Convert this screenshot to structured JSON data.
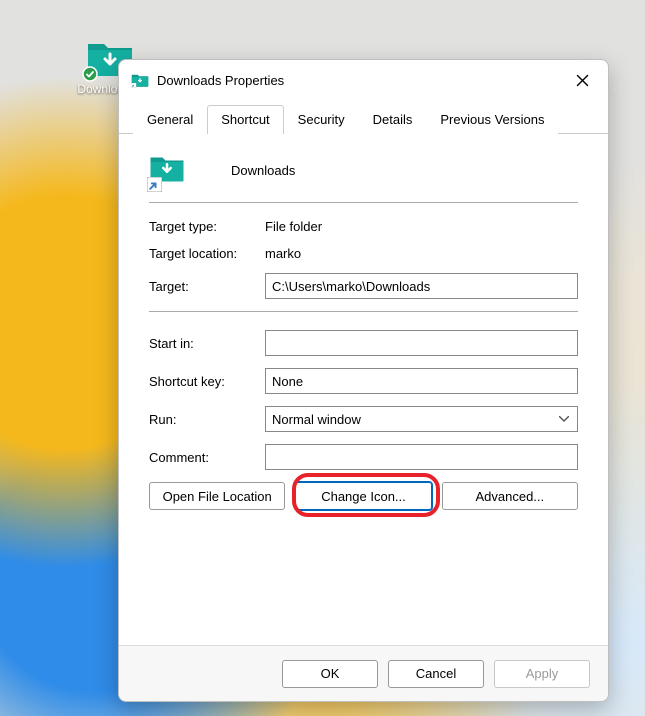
{
  "desktop": {
    "icon_label": "Download…"
  },
  "dialog": {
    "title": "Downloads Properties",
    "tabs": [
      "General",
      "Shortcut",
      "Security",
      "Details",
      "Previous Versions"
    ],
    "active_tab": "Shortcut",
    "icon_name": "Downloads",
    "fields": {
      "target_type_label": "Target type:",
      "target_type_value": "File folder",
      "target_location_label": "Target location:",
      "target_location_value": "marko",
      "target_label": "Target:",
      "target_value": "C:\\Users\\marko\\Downloads",
      "start_in_label": "Start in:",
      "start_in_value": "",
      "shortcut_key_label": "Shortcut key:",
      "shortcut_key_value": "None",
      "run_label": "Run:",
      "run_value": "Normal window",
      "comment_label": "Comment:",
      "comment_value": ""
    },
    "buttons": {
      "open_file_location": "Open File Location",
      "change_icon": "Change Icon...",
      "advanced": "Advanced..."
    },
    "footer": {
      "ok": "OK",
      "cancel": "Cancel",
      "apply": "Apply"
    }
  }
}
